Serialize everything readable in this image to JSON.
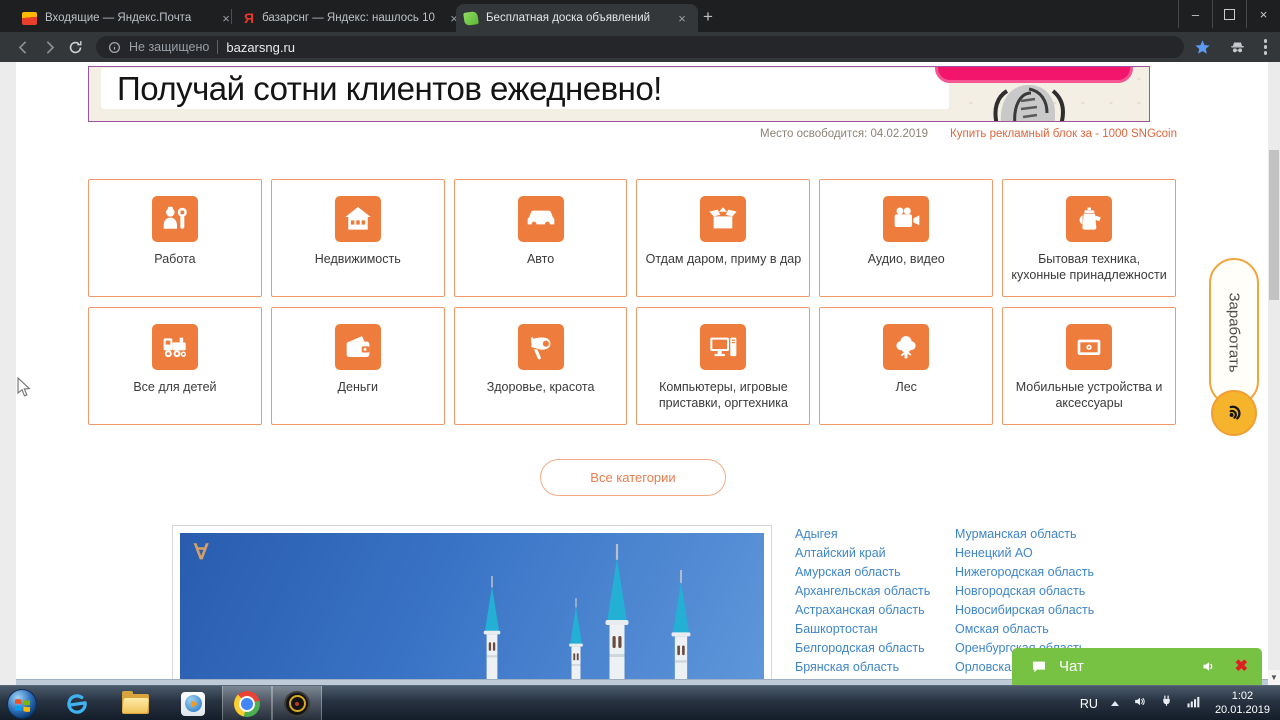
{
  "browser": {
    "tabs": [
      {
        "title": "Входящие — Яндекс.Почта",
        "icon": "yandex-mail-icon",
        "active": false
      },
      {
        "title": "базарснг — Яндекс: нашлось 10",
        "icon": "yandex-search-icon",
        "fav_letter": "Я",
        "active": false
      },
      {
        "title": "Бесплатная доска объявлений",
        "icon": "bulletin-board-icon",
        "active": true
      }
    ],
    "tab_close_glyph": "×",
    "new_tab_glyph": "+",
    "window_controls": {
      "minimize": "–",
      "close": "×"
    },
    "address": {
      "security_text": "Не защищено",
      "url": "bazarsng.ru"
    }
  },
  "page": {
    "banner": {
      "headline": "Получай сотни клиентов ежедневно!"
    },
    "ad_meta": {
      "expires": "Место освободится: 04.02.2019",
      "buy_link": "Купить рекламный блок за - 1000 SNGcoin"
    },
    "categories": [
      {
        "label": "Работа",
        "icon": "worker"
      },
      {
        "label": "Недвижимость",
        "icon": "house"
      },
      {
        "label": "Авто",
        "icon": "car"
      },
      {
        "label": "Отдам даром, приму в дар",
        "icon": "open-box"
      },
      {
        "label": "Аудио, видео",
        "icon": "video-camera"
      },
      {
        "label": "Бытовая техника, кухонные принадлежности",
        "icon": "kettle"
      },
      {
        "label": "Все для детей",
        "icon": "toy-train"
      },
      {
        "label": "Деньги",
        "icon": "wallet"
      },
      {
        "label": "Здоровье, красота",
        "icon": "hair-dryer"
      },
      {
        "label": "Компьютеры, игровые приставки, оргтехника",
        "icon": "computer"
      },
      {
        "label": "Лес",
        "icon": "tree"
      },
      {
        "label": "Мобильные устройства и аксессуары",
        "icon": "mobile-device"
      }
    ],
    "all_categories_label": "Все категории",
    "slider": {
      "overlay_letter": "∀"
    },
    "regions": {
      "column1": [
        "Адыгея",
        "Алтайский край",
        "Амурская область",
        "Архангельская область",
        "Астраханская область",
        "Башкортостан",
        "Белгородская область",
        "Брянская область"
      ],
      "column2": [
        "Мурманская область",
        "Ненецкий АО",
        "Нижегородская область",
        "Новгородская область",
        "Новосибирская область",
        "Омская область",
        "Оренбургская область",
        "Орловская область"
      ]
    },
    "earn_tab_label": "Заработать",
    "chat": {
      "label": "Чат",
      "close_glyph": "✖"
    }
  },
  "taskbar": {
    "language": "RU",
    "time": "1:02",
    "date": "20.01.2019"
  },
  "colors": {
    "accent_orange": "#ed7c3d",
    "card_border": "#f0996b",
    "link_blue": "#3f86c8",
    "chat_green": "#77c143",
    "banner_border": "#9c559c",
    "buy_link_orange": "#e2653c",
    "pink_button": "#f2156b",
    "earn_yellow": "#f6b42c"
  }
}
